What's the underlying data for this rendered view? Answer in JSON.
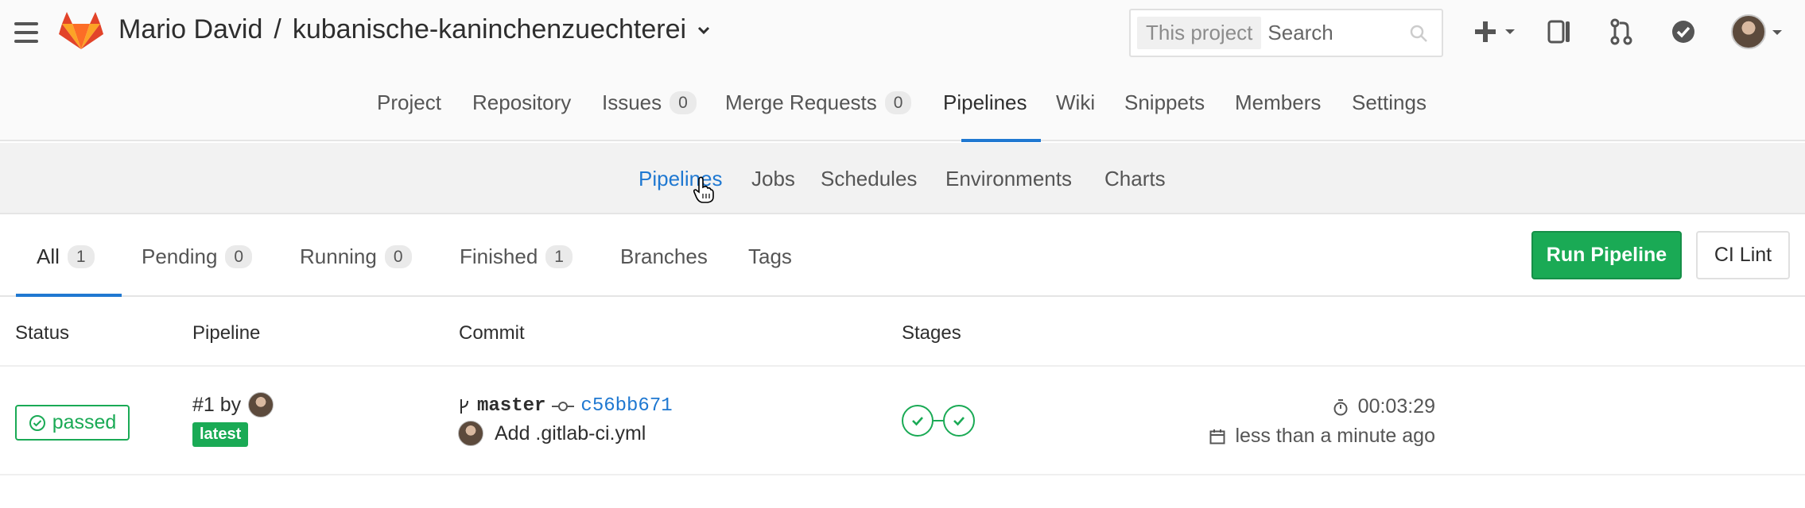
{
  "header": {
    "owner": "Mario David",
    "separator": "/",
    "project": "kubanische-kaninchenzuechterei",
    "search_scope": "This project",
    "search_placeholder": "Search"
  },
  "project_nav": [
    {
      "label": "Project",
      "badge": null
    },
    {
      "label": "Repository",
      "badge": null
    },
    {
      "label": "Issues",
      "badge": "0"
    },
    {
      "label": "Merge Requests",
      "badge": "0"
    },
    {
      "label": "Pipelines",
      "badge": null,
      "active": true
    },
    {
      "label": "Wiki",
      "badge": null
    },
    {
      "label": "Snippets",
      "badge": null
    },
    {
      "label": "Members",
      "badge": null
    },
    {
      "label": "Settings",
      "badge": null
    }
  ],
  "sub_nav": [
    {
      "label": "Pipelines",
      "active": true
    },
    {
      "label": "Jobs"
    },
    {
      "label": "Schedules"
    },
    {
      "label": "Environments"
    },
    {
      "label": "Charts"
    }
  ],
  "filter_tabs": [
    {
      "label": "All",
      "count": "1",
      "active": true
    },
    {
      "label": "Pending",
      "count": "0"
    },
    {
      "label": "Running",
      "count": "0"
    },
    {
      "label": "Finished",
      "count": "1"
    },
    {
      "label": "Branches",
      "count": null
    },
    {
      "label": "Tags",
      "count": null
    }
  ],
  "actions": {
    "run_pipeline": "Run Pipeline",
    "ci_lint": "CI Lint"
  },
  "table": {
    "columns": [
      "Status",
      "Pipeline",
      "Commit",
      "Stages"
    ],
    "rows": [
      {
        "status": "passed",
        "pipeline": "#1 by",
        "tag": "latest",
        "branch": "master",
        "sha": "c56bb671",
        "message": "Add .gitlab-ci.yml",
        "stages": [
          "passed",
          "passed"
        ],
        "duration": "00:03:29",
        "finished": "less than a minute ago"
      }
    ]
  },
  "colors": {
    "accent": "#1f78d1",
    "success": "#1aaa55",
    "logo_orange": "#fc6d26"
  }
}
